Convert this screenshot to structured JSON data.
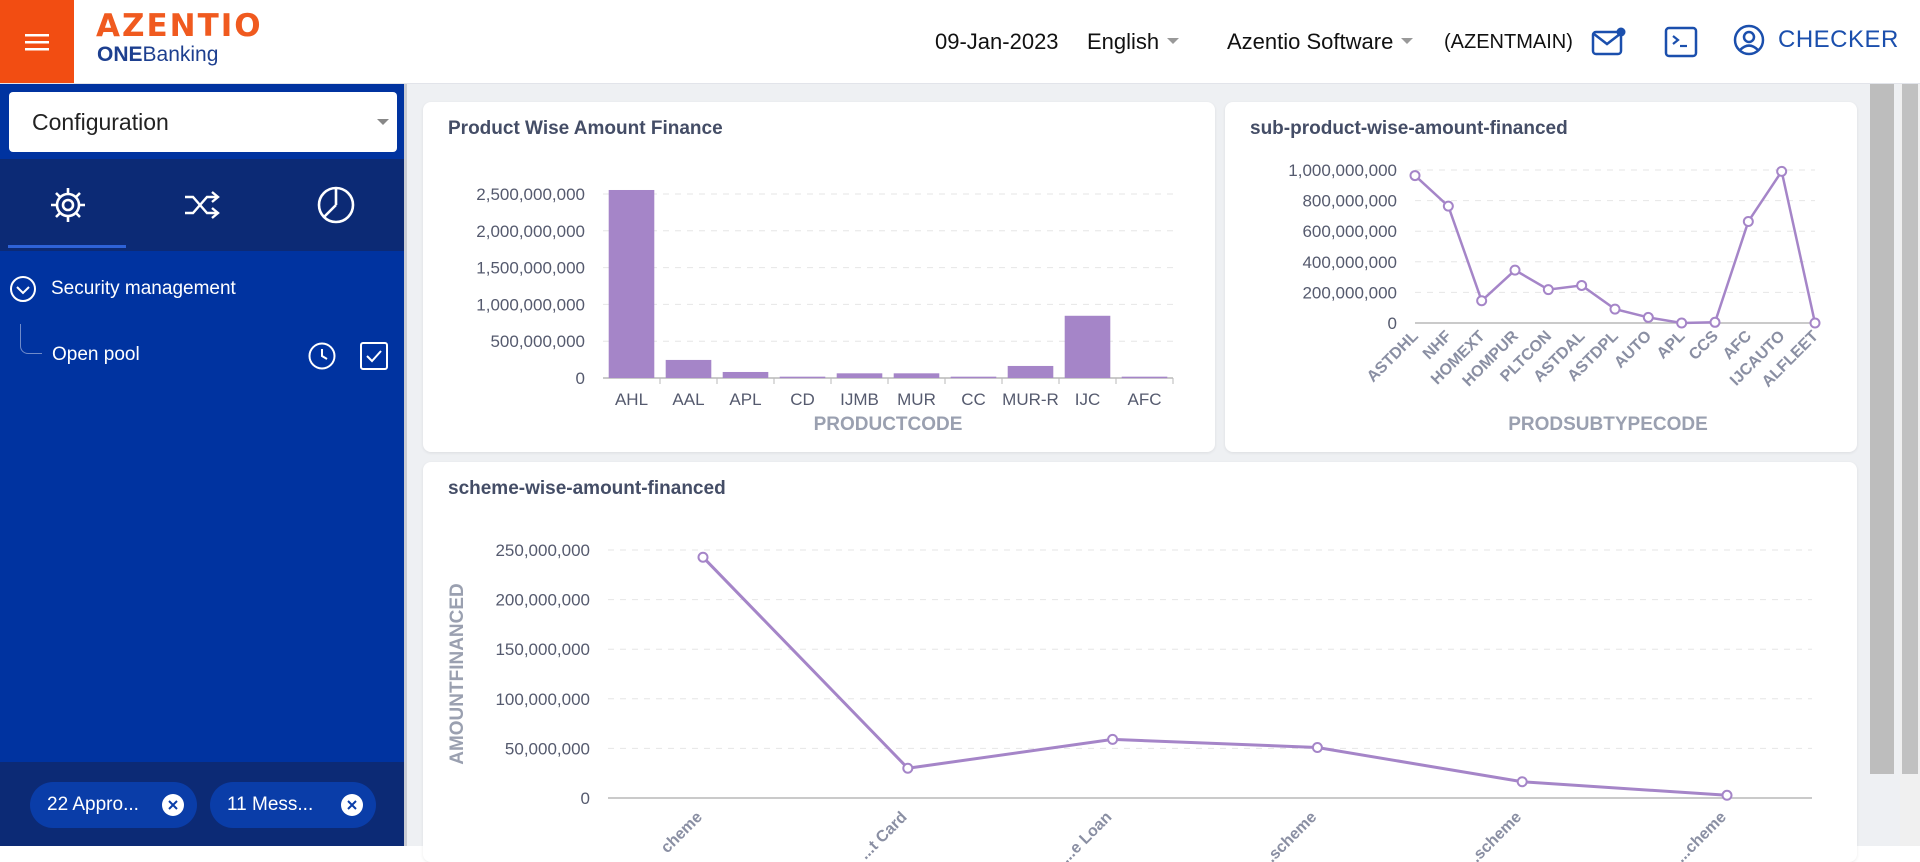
{
  "header": {
    "logo_brand": "AZENTIO",
    "logo_sub_bold": "ONE",
    "logo_sub_rest": "Banking",
    "date": "09-Jan-2023",
    "language": "English",
    "company": "Azentio Software",
    "branch": "(AZENTMAIN)",
    "user": "CHECKER"
  },
  "sidebar": {
    "module_select": "Configuration",
    "tree_root": "Security management",
    "tree_child": "Open pool",
    "chips": [
      "22 Appro...",
      "11 Mess..."
    ]
  },
  "charts": {
    "product": {
      "title": "Product Wise Amount Finance",
      "xlabel": "PRODUCTCODE"
    },
    "subproduct": {
      "title": "sub-product-wise-amount-financed",
      "xlabel": "PRODSUBTYPECODE"
    },
    "scheme": {
      "title": "scheme-wise-amount-financed",
      "ylabel": "AMOUNTFINANCED"
    }
  },
  "colors": {
    "accent": "#f24d12",
    "sidebar": "#0033a0",
    "series": "#a585c8"
  },
  "chart_data": [
    {
      "type": "bar",
      "title": "Product Wise Amount Finance",
      "xlabel": "PRODUCTCODE",
      "categories": [
        "AHL",
        "AAL",
        "APL",
        "CD",
        "IJMB",
        "MUR",
        "CC",
        "MUR-R",
        "IJC",
        "AFC"
      ],
      "values": [
        2810000000,
        270000000,
        90000000,
        20000000,
        70000000,
        70000000,
        20000000,
        180000000,
        930000000,
        20000000
      ],
      "yticks": [
        "0",
        "500,000,000",
        "1,000,000,000",
        "1,500,000,000",
        "2,000,000,000",
        "2,500,000,000"
      ],
      "ylim": [
        0,
        2750000000
      ]
    },
    {
      "type": "line",
      "title": "sub-product-wise-amount-financed",
      "xlabel": "PRODSUBTYPECODE",
      "categories": [
        "ASTDHL",
        "NHF",
        "HOMEXT",
        "HOMPUR",
        "PLTCON",
        "ASTDAL",
        "ASTDPL",
        "AUTO",
        "APL",
        "CCS",
        "AFC",
        "IJCAUTO",
        "ALFLEET"
      ],
      "values": [
        1060000000,
        840000000,
        160000000,
        380000000,
        240000000,
        270000000,
        100000000,
        40000000,
        0,
        5000000,
        730000000,
        1090000000,
        0
      ],
      "yticks": [
        "0",
        "200,000,000",
        "400,000,000",
        "600,000,000",
        "800,000,000",
        "1,000,000,000"
      ],
      "ylim": [
        0,
        1100000000
      ]
    },
    {
      "type": "line",
      "title": "scheme-wise-amount-financed",
      "ylabel": "AMOUNTFINANCED",
      "categories": [
        "cheme",
        "...t Card",
        "...e Loan",
        "...scheme",
        "...scheme",
        "...cheme"
      ],
      "values": [
        267000000,
        33000000,
        65000000,
        56000000,
        18000000,
        3000000
      ],
      "yticks": [
        "0",
        "50,000,000",
        "100,000,000",
        "150,000,000",
        "200,000,000",
        "250,000,000"
      ],
      "ylim": [
        0,
        275000000
      ]
    }
  ]
}
